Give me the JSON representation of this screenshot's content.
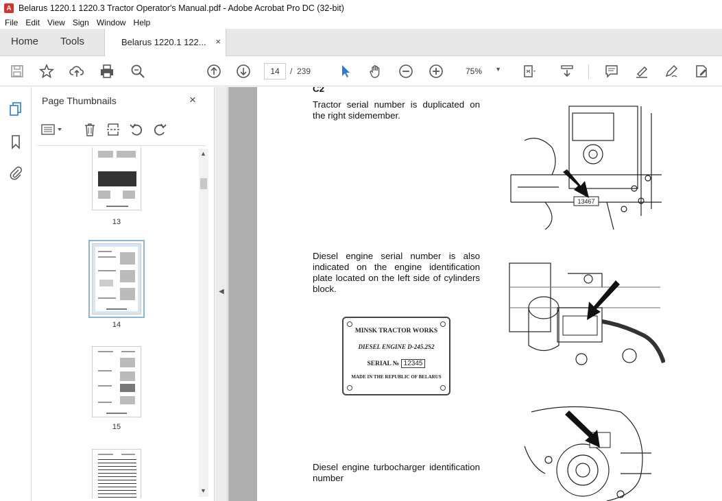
{
  "window": {
    "title": "Belarus 1220.1 1220.3 Tractor Operator's Manual.pdf - Adobe Acrobat Pro DC (32-bit)"
  },
  "menu": [
    "File",
    "Edit",
    "View",
    "Sign",
    "Window",
    "Help"
  ],
  "tabs": {
    "home": "Home",
    "tools": "Tools",
    "document": "Belarus 1220.1 122...",
    "close": "×"
  },
  "toolbar": {
    "current_page": "14",
    "separator": "/",
    "total_pages": "239",
    "zoom": "75%"
  },
  "thumbnail_panel": {
    "title": "Page Thumbnails",
    "close": "×",
    "thumbs": [
      {
        "label": "13"
      },
      {
        "label": "14"
      },
      {
        "label": "15"
      }
    ]
  },
  "document": {
    "section_heading": "C2",
    "p1": "Tractor serial number is duplicated on the right sidemember.",
    "p2": "Diesel engine serial number is also indicated on the engine identification plate located on the left side of cylinders block.",
    "p3": "Diesel engine turbocharger identification number",
    "plate": {
      "line1": "MINSK TRACTOR WORKS",
      "line2": "DIESEL ENGINE D-245.2S2",
      "serial_label": "SERIAL №",
      "serial_value": "12345",
      "line4": "MADE IN THE REPUBLIC OF BELARUS"
    },
    "illustration1_label": "13467"
  },
  "colors": {
    "acrobat_red": "#d9302c",
    "selected_blue": "#2a7bd4",
    "viewport_gray": "#aeaeae"
  }
}
